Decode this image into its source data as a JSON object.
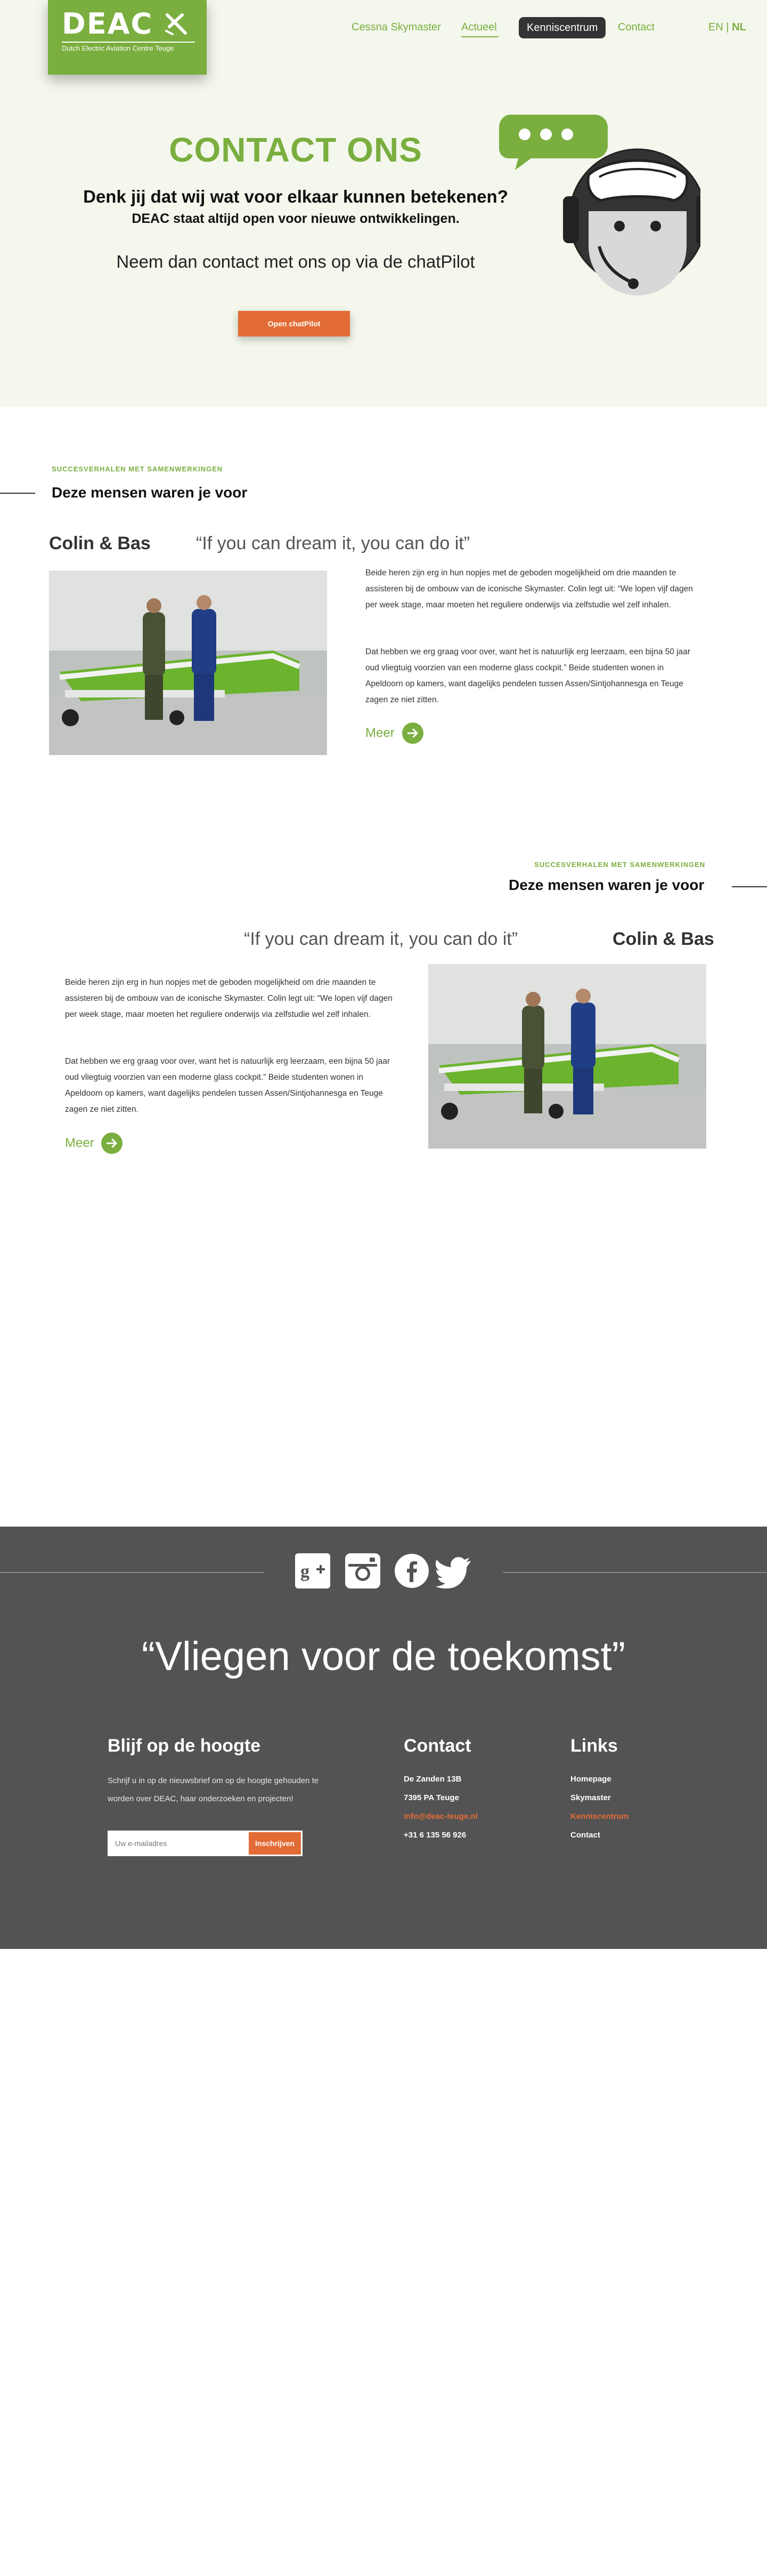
{
  "logo": {
    "word": "DEAC",
    "subtitle": "Dutch Electric Aviation Centre Teuge"
  },
  "nav": {
    "items": [
      "Cessna Skymaster",
      "Actueel",
      "Kenniscentrum",
      "Contact"
    ],
    "active": "Actueel",
    "highlighted": "Kenniscentrum"
  },
  "lang": {
    "en": "EN",
    "separator": "|",
    "nl": "NL",
    "active": "NL"
  },
  "hero": {
    "title": "CONTACT ONS",
    "question": "Denk jij dat wij wat voor elkaar kunnen betekenen?",
    "sub": "DEAC staat altijd open voor nieuwe ontwikkelingen.",
    "contact_line": "Neem dan contact met ons op via de chatPilot",
    "button": "Open chatPilot"
  },
  "stories": [
    {
      "eyebrow": "SUCCESVERHALEN MET SAMENWERKINGEN",
      "title": "Deze mensen waren je voor",
      "names": "Colin & Bas",
      "quote": "“If you can dream it, you can do it”",
      "paragraph1": "Beide heren zijn erg in hun nopjes met de geboden mogelijkheid om drie maanden te assisteren bij de ombouw van de iconische Skymaster. Colin legt uit: “We lopen vijf dagen per week stage, maar moeten het reguliere onderwijs via zelfstudie wel zelf inhalen.",
      "paragraph2": "Dat hebben we erg graag voor over, want  het is natuurlijk erg leerzaam, een bijna 50 jaar oud vliegtuig voorzien van een moderne glass cockpit.” Beide studenten wonen in Apeldoorn op kamers, want dagelijks pendelen tussen Assen/Sintjohannesga en Teuge zagen ze niet zitten.",
      "more": "Meer"
    },
    {
      "eyebrow": "SUCCESVERHALEN MET SAMENWERKINGEN",
      "title": "Deze mensen waren je voor",
      "names": "Colin & Bas",
      "quote": "“If you can dream it, you can do it”",
      "paragraph1": "Beide heren zijn erg in hun nopjes met de geboden mogelijkheid om drie maanden te assisteren bij de ombouw van de iconische Skymaster. Colin legt uit: “We lopen vijf dagen per week stage, maar moeten het reguliere onderwijs via zelfstudie wel zelf inhalen.",
      "paragraph2": "Dat hebben we erg graag voor over, want  het is natuurlijk erg leerzaam, een bijna 50 jaar oud vliegtuig voorzien van een moderne glass cockpit.” Beide studenten wonen in Apeldoorn op kamers, want dagelijks pendelen tussen Assen/Sintjohannesga en Teuge zagen ze niet zitten.",
      "more": "Meer"
    }
  ],
  "footer": {
    "social": [
      "google-plus-icon",
      "instagram-icon",
      "facebook-icon",
      "twitter-icon"
    ],
    "quote": "“Vliegen voor de toekomst”",
    "newsletter": {
      "title": "Blijf op de hoogte",
      "text": "Schrijf u in op de nieuwsbrief om op de hoogte gehouden te worden over DEAC, haar onderzoeken en projecten!",
      "placeholder": "Uw e-mailadres",
      "button": "Inschrijven"
    },
    "contact": {
      "title": "Contact",
      "address": "De Zanden 13B",
      "postal": "7395 PA Teuge",
      "email": "info@deac-teuge.nl",
      "phone": "+31 6 135 56 926"
    },
    "links": {
      "title": "Links",
      "items": [
        "Homepage",
        "Skymaster",
        "Kenniscentrum",
        "Contact"
      ],
      "highlighted": "Kenniscentrum"
    }
  },
  "colors": {
    "brand_green": "#7aae3f",
    "accent_orange": "#e36b35",
    "footer_grey": "#535353",
    "hero_bg": "#f3f7ec"
  }
}
